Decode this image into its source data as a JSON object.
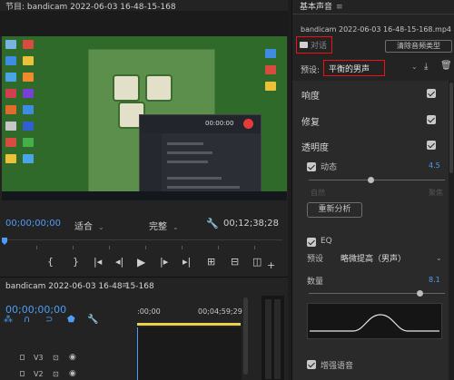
{
  "program": {
    "title": "节目: bandicam 2022-06-03 16-48-15-168",
    "timecode": "00;00;00;00",
    "fit_dropdown": "适合",
    "quality_dropdown": "完整",
    "duration": "00;12;38;28",
    "bandicam_time": "00:00:00"
  },
  "transport": {
    "mark_in": "{",
    "mark_out": "}",
    "go_in": "|◂",
    "step_back": "◂|",
    "play": "▶",
    "step_fwd": "|▸",
    "go_out": "▸|",
    "add": "+"
  },
  "timeline": {
    "sequence_name": "bandicam 2022-06-03 16-48-15-168",
    "menu": "≡",
    "timecode": "00;00;00;00",
    "ruler_start": ":00;00",
    "ruler_mark": "00;04;59;29",
    "tracks": [
      {
        "name": "V3"
      },
      {
        "name": "V2"
      }
    ]
  },
  "panel": {
    "title": "基本声音",
    "menu_icon": "≡",
    "file_name": "bandicam 2022-06-03 16-48-15-168.mp4",
    "dialogue_tag": "对话",
    "clear_button": "清除音频类型",
    "preset_label": "预设:",
    "preset_value": "平衡的男声",
    "sections": {
      "loudness": "响度",
      "repair": "修复",
      "clarity": "透明度"
    },
    "dynamics": {
      "label": "动态",
      "value": "4.5",
      "level": 0.45,
      "left": "自然",
      "right": "聚焦"
    },
    "reanalyze": "重新分析",
    "eq": {
      "label": "EQ",
      "preset_label": "预设",
      "preset_value": "略微提高（男声）",
      "amount_label": "数量",
      "amount_value": "8.1",
      "amount_level": 0.81
    },
    "enhance": "增强语音"
  },
  "colors": {
    "accent": "#4d9df6",
    "highlight_border": "#ee1111",
    "playhead_bar": "#e8d34a"
  }
}
